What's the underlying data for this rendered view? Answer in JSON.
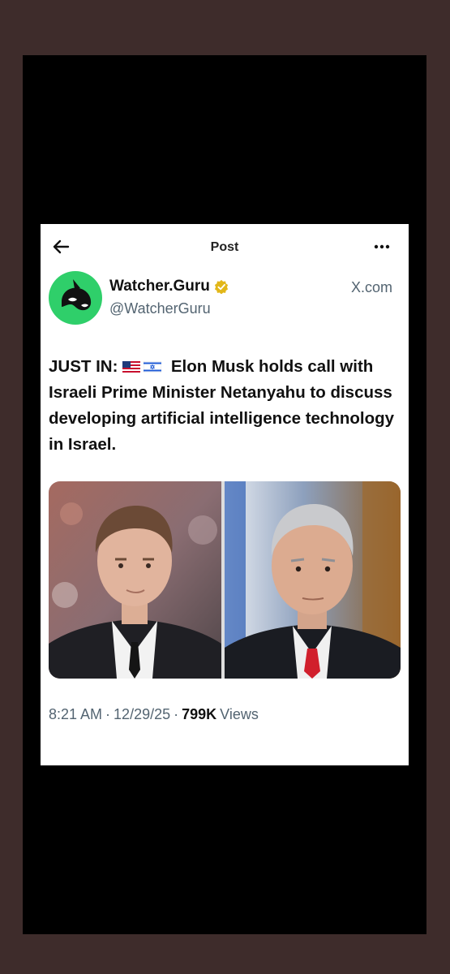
{
  "header": {
    "title": "Post"
  },
  "account": {
    "display_name": "Watcher.Guru",
    "handle": "@WatcherGuru",
    "source": "X.com",
    "avatar_color": "#2fcf6a",
    "verified_color": "#e2b719"
  },
  "post": {
    "prefix": "JUST IN:",
    "flags": [
      "us-flag-icon",
      "israel-flag-icon"
    ],
    "text": "Elon Musk holds call with Israeli Prime Minister Netanyahu to discuss developing artificial intelligence technology in Israel."
  },
  "meta": {
    "time": "8:21 AM",
    "date": "12/29/25",
    "views_count": "799K",
    "views_label": "Views",
    "separator": "·"
  },
  "icons": {
    "back": "arrow-left-icon",
    "more": "more-dots-icon",
    "verified": "verified-badge-icon"
  }
}
